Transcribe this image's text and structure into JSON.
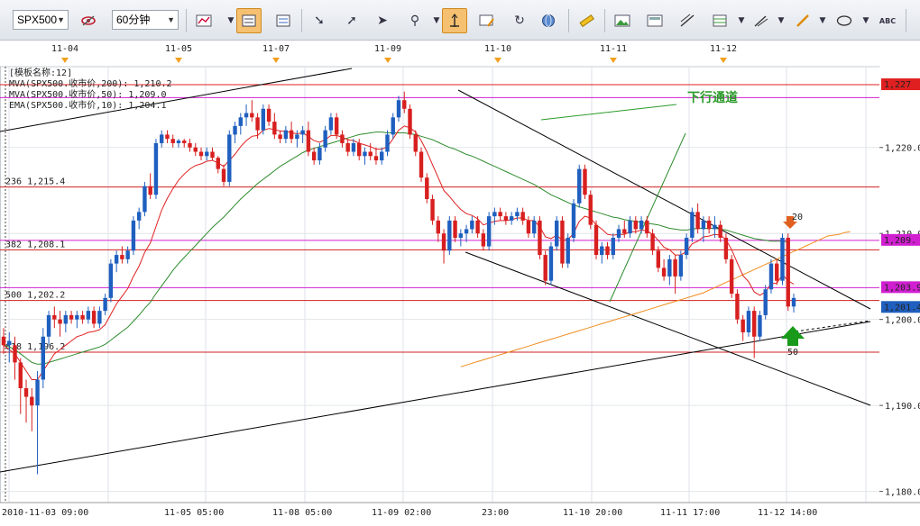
{
  "toolbar": {
    "symbol": "SPX500",
    "interval": "60分钟",
    "icons": [
      "eye-off-icon",
      "bar-chart-icon",
      "layout-icon",
      "layout-alt-icon",
      "pointer-icon",
      "pointer-plus-icon",
      "cursor-icon",
      "zoom-icon",
      "crosshair-icon",
      "edit-chart-icon",
      "refresh-icon",
      "globe-icon",
      "ruler-icon",
      "image-icon",
      "image-alt-icon",
      "trend-tool-icon",
      "grid-tool-icon",
      "pen-tool-icon",
      "brush-icon",
      "ellipse-icon",
      "text-icon"
    ]
  },
  "colors": {
    "bull": "#1f5fbf",
    "bear": "#d81f1f",
    "ema10": "#e02020",
    "ma50": "#2e8b2e",
    "ma200": "#f08c1c",
    "hline_red": "#d22020",
    "hline_magenta": "#d020d0",
    "channel": "#000000",
    "annotation_green": "#2a9a2a"
  },
  "chart_data": {
    "type": "candlestick",
    "symbol": "SPX500",
    "timeframe": "60分钟",
    "template_label": "[模板名称:12]",
    "legend": [
      {
        "text": "MVA(SPX500.收市价,200): 1,210.2",
        "color": "#f08c1c"
      },
      {
        "text": "MVA(SPX500.收市价,50): 1,209.0",
        "color": "#2e8b2e"
      },
      {
        "text": "EMA(SPX500.收市价,10): 1,204.1",
        "color": "#e02020"
      }
    ],
    "top_date_labels": [
      "11-04",
      "11-05",
      "11-07",
      "11-09",
      "11-10",
      "11-11",
      "11-12"
    ],
    "x_labels": [
      "2010-11-03 09:00",
      "11-05 05:00",
      "11-08 05:00",
      "11-09 02:00",
      "23:00",
      "11-10 20:00",
      "11-11 17:00",
      "11-12 14:00"
    ],
    "y_ticks": [
      "1,220.0",
      "1,210.0",
      "1,200.0",
      "1,190.0",
      "1,180.0"
    ],
    "ylim": [
      1178.7,
      1229.4
    ],
    "price_labels": [
      {
        "value": "1,227",
        "color": "#e02020"
      },
      {
        "value": "1,209.",
        "color": "#d020d0"
      },
      {
        "value": "1,203.9",
        "color": "#d020d0"
      },
      {
        "value": "1,201.4",
        "color": "#1f5fbf"
      }
    ],
    "fib_levels": [
      {
        "label": "236  1,215.4",
        "price": 1215.4
      },
      {
        "label": "382  1,208.1",
        "price": 1208.1
      },
      {
        "label": "500  1,202.2",
        "price": 1202.2
      },
      {
        "label": "618  1,196.2",
        "price": 1196.2
      }
    ],
    "horizontal_lines": [
      {
        "price": 1227.3,
        "color": "#e02020"
      },
      {
        "price": 1225.8,
        "color": "#d020d0"
      },
      {
        "price": 1209.2,
        "color": "#d020d0"
      },
      {
        "price": 1203.7,
        "color": "#d020d0"
      }
    ],
    "annotation_text": "下行通道",
    "signals": [
      {
        "label": "20",
        "type": "down"
      },
      {
        "label": "50",
        "type": "up"
      }
    ],
    "candles": [
      [
        1198,
        1199,
        1196,
        1197
      ],
      [
        1197,
        1198.5,
        1195,
        1197.5
      ],
      [
        1197,
        1198,
        1193,
        1195
      ],
      [
        1195,
        1195.5,
        1189,
        1192
      ],
      [
        1192,
        1193,
        1188,
        1191
      ],
      [
        1191,
        1192,
        1187,
        1190
      ],
      [
        1190,
        1194,
        1182,
        1193
      ],
      [
        1193,
        1199,
        1192,
        1198
      ],
      [
        1198,
        1201,
        1197,
        1200.5
      ],
      [
        1200.5,
        1201.5,
        1199,
        1200
      ],
      [
        1200,
        1201,
        1198,
        1199.5
      ],
      [
        1199.5,
        1201,
        1198.5,
        1200.5
      ],
      [
        1200.5,
        1201,
        1199.5,
        1200
      ],
      [
        1200,
        1201,
        1199,
        1200.5
      ],
      [
        1200.5,
        1201,
        1199.5,
        1200
      ],
      [
        1200,
        1201.5,
        1199.5,
        1201
      ],
      [
        1201,
        1201.5,
        1199,
        1199.5
      ],
      [
        1199.5,
        1201.5,
        1199,
        1201
      ],
      [
        1201,
        1203,
        1200.5,
        1202.5
      ],
      [
        1202.5,
        1207,
        1202,
        1206.5
      ],
      [
        1206.5,
        1208,
        1205.5,
        1207.5
      ],
      [
        1207.5,
        1208.5,
        1206.5,
        1207
      ],
      [
        1207,
        1208.5,
        1206.5,
        1208
      ],
      [
        1208,
        1212,
        1207.5,
        1211.5
      ],
      [
        1211.5,
        1213,
        1210.5,
        1212.5
      ],
      [
        1212.5,
        1216,
        1212,
        1215.5
      ],
      [
        1215.5,
        1217,
        1214,
        1214.5
      ],
      [
        1214.5,
        1221,
        1214,
        1220.5
      ],
      [
        1220.5,
        1222,
        1220,
        1221.5
      ],
      [
        1221.5,
        1222,
        1220.5,
        1221
      ],
      [
        1221,
        1221.5,
        1220,
        1220.5
      ],
      [
        1220.5,
        1221,
        1220,
        1220.8
      ],
      [
        1220.8,
        1221,
        1220,
        1220.5
      ],
      [
        1220.5,
        1221,
        1219.5,
        1220
      ],
      [
        1220,
        1220.5,
        1219,
        1219.5
      ],
      [
        1219.5,
        1220,
        1218.5,
        1219
      ],
      [
        1219,
        1220,
        1218.5,
        1219.5
      ],
      [
        1219.5,
        1220,
        1218.5,
        1218.8
      ],
      [
        1218.8,
        1219,
        1217,
        1217.5
      ],
      [
        1217.5,
        1218,
        1215.5,
        1216
      ],
      [
        1216,
        1222,
        1215.5,
        1221.5
      ],
      [
        1221.5,
        1223,
        1220.5,
        1222.5
      ],
      [
        1222.5,
        1224,
        1221.5,
        1223.5
      ],
      [
        1223.5,
        1225,
        1222.5,
        1224
      ],
      [
        1224,
        1225.5,
        1223,
        1223.5
      ],
      [
        1223.5,
        1224,
        1221,
        1222
      ],
      [
        1222,
        1225,
        1221.5,
        1224.5
      ],
      [
        1224.5,
        1225,
        1222.5,
        1223
      ],
      [
        1223,
        1224,
        1221,
        1221.5
      ],
      [
        1221.5,
        1222,
        1220.5,
        1221
      ],
      [
        1221,
        1222.5,
        1220.5,
        1222
      ],
      [
        1222,
        1223,
        1220.5,
        1221
      ],
      [
        1221,
        1222,
        1220,
        1221.5
      ],
      [
        1221.5,
        1222.5,
        1220.5,
        1222
      ],
      [
        1222,
        1223,
        1219,
        1219.5
      ],
      [
        1219.5,
        1220,
        1218,
        1218.5
      ],
      [
        1218.5,
        1220.5,
        1218,
        1220
      ],
      [
        1220,
        1222.5,
        1219.5,
        1222
      ],
      [
        1222,
        1224,
        1221.5,
        1223.5
      ],
      [
        1223.5,
        1224,
        1221,
        1221.5
      ],
      [
        1221.5,
        1222,
        1220,
        1220.5
      ],
      [
        1220.5,
        1221,
        1219,
        1219.5
      ],
      [
        1219.5,
        1221,
        1219,
        1220.5
      ],
      [
        1220.5,
        1221,
        1218.5,
        1219
      ],
      [
        1219,
        1220,
        1218,
        1219.5
      ],
      [
        1219.5,
        1220.5,
        1218.5,
        1219
      ],
      [
        1219,
        1220,
        1218,
        1218.5
      ],
      [
        1218.5,
        1220,
        1218,
        1219.5
      ],
      [
        1219.5,
        1222,
        1219,
        1221.5
      ],
      [
        1221.5,
        1224,
        1221,
        1223.5
      ],
      [
        1223.5,
        1226,
        1223,
        1225.5
      ],
      [
        1225.5,
        1226.5,
        1224,
        1224.5
      ],
      [
        1224.5,
        1225,
        1221,
        1221.5
      ],
      [
        1221.5,
        1222,
        1219,
        1219.5
      ],
      [
        1219.5,
        1220,
        1216,
        1216.5
      ],
      [
        1216.5,
        1217,
        1213.5,
        1214
      ],
      [
        1214,
        1214.5,
        1211,
        1211.5
      ],
      [
        1211.5,
        1212,
        1209,
        1210
      ],
      [
        1210,
        1210.5,
        1206.5,
        1208
      ],
      [
        1208,
        1212,
        1207.5,
        1211.5
      ],
      [
        1211.5,
        1212,
        1209,
        1209.5
      ],
      [
        1209.5,
        1210.5,
        1208.5,
        1210
      ],
      [
        1210,
        1211,
        1209,
        1210.5
      ],
      [
        1210.5,
        1212,
        1210,
        1211.5
      ],
      [
        1211.5,
        1212,
        1209.5,
        1210
      ],
      [
        1210,
        1210.5,
        1208,
        1208.5
      ],
      [
        1208.5,
        1212.5,
        1208,
        1212
      ],
      [
        1212,
        1213,
        1211,
        1212.5
      ],
      [
        1212.5,
        1213,
        1211.5,
        1212
      ],
      [
        1212,
        1212.5,
        1211,
        1211.5
      ],
      [
        1211.5,
        1212.5,
        1211,
        1212
      ],
      [
        1212,
        1213,
        1211.5,
        1212.5
      ],
      [
        1212.5,
        1213,
        1211,
        1211.5
      ],
      [
        1211.5,
        1212,
        1209.5,
        1210
      ],
      [
        1210,
        1212,
        1209.5,
        1211.5
      ],
      [
        1211.5,
        1212,
        1207,
        1207.5
      ],
      [
        1207.5,
        1208,
        1204,
        1204.5
      ],
      [
        1204.5,
        1209,
        1204,
        1208.5
      ],
      [
        1208.5,
        1212,
        1208,
        1211.5
      ],
      [
        1211.5,
        1212,
        1206,
        1206.5
      ],
      [
        1206.5,
        1210,
        1206,
        1209.5
      ],
      [
        1209.5,
        1214,
        1209,
        1213.5
      ],
      [
        1213.5,
        1218,
        1213,
        1217.5
      ],
      [
        1217.5,
        1218,
        1214,
        1214.5
      ],
      [
        1214.5,
        1215,
        1210.5,
        1211
      ],
      [
        1211,
        1211.5,
        1207,
        1207.5
      ],
      [
        1207.5,
        1209,
        1206.5,
        1208.5
      ],
      [
        1208.5,
        1209,
        1207,
        1207.5
      ],
      [
        1207.5,
        1210,
        1207,
        1209.5
      ],
      [
        1209.5,
        1211,
        1209,
        1210.5
      ],
      [
        1210.5,
        1211.5,
        1209.5,
        1210
      ],
      [
        1210,
        1212,
        1209.5,
        1211.5
      ],
      [
        1211.5,
        1212,
        1210,
        1210.5
      ],
      [
        1210.5,
        1212,
        1210,
        1211.5
      ],
      [
        1211.5,
        1212,
        1209.5,
        1210
      ],
      [
        1210,
        1210.5,
        1207.5,
        1208
      ],
      [
        1208,
        1208.5,
        1205.5,
        1206
      ],
      [
        1206,
        1207,
        1204.5,
        1205
      ],
      [
        1205,
        1207.5,
        1204,
        1207
      ],
      [
        1207,
        1207.5,
        1203,
        1205
      ],
      [
        1205,
        1208,
        1204.5,
        1207.5
      ],
      [
        1207.5,
        1210,
        1207,
        1209.5
      ],
      [
        1209.5,
        1213,
        1209,
        1212.5
      ],
      [
        1212.5,
        1213.5,
        1210,
        1210.5
      ],
      [
        1210.5,
        1212,
        1209,
        1211.5
      ],
      [
        1211.5,
        1212,
        1210,
        1210.5
      ],
      [
        1210.5,
        1212,
        1209.5,
        1211
      ],
      [
        1211,
        1211.5,
        1209,
        1209.5
      ],
      [
        1209.5,
        1210,
        1206.5,
        1207
      ],
      [
        1207,
        1207.5,
        1202.5,
        1203
      ],
      [
        1203,
        1203.5,
        1199.5,
        1200
      ],
      [
        1200,
        1200.5,
        1197.5,
        1198.5
      ],
      [
        1198.5,
        1201.5,
        1198,
        1201
      ],
      [
        1201,
        1201.5,
        1195.5,
        1198
      ],
      [
        1198,
        1201,
        1197.5,
        1200.5
      ],
      [
        1200.5,
        1204,
        1200,
        1203.5
      ],
      [
        1203.5,
        1207,
        1203,
        1206.5
      ],
      [
        1206.5,
        1207,
        1204,
        1204.5
      ],
      [
        1204.5,
        1210,
        1204,
        1209.5
      ],
      [
        1209.5,
        1210,
        1201,
        1201.5
      ],
      [
        1201.5,
        1203,
        1200.8,
        1202.5
      ]
    ],
    "ema10": [
      1197,
      1196.5,
      1196,
      1195,
      1194,
      1193,
      1193,
      1194,
      1195,
      1196,
      1196.5,
      1197,
      1197.5,
      1198,
      1198.2,
      1198.5,
      1198.6,
      1198.8,
      1199.4,
      1200.6,
      1201.8,
      1202.7,
      1203.6,
      1205,
      1206.2,
      1207.8,
      1208.9,
      1210.8,
      1212.7,
      1214.1,
      1215.2,
      1216.2,
      1216.9,
      1217.5,
      1217.9,
      1218.1,
      1218.4,
      1218.5,
      1218.2,
      1217.8,
      1218.5,
      1219.2,
      1220.1,
      1220.8,
      1221.3,
      1221.4,
      1222,
      1222.2,
      1222.1,
      1221.9,
      1221.9,
      1221.7,
      1221.6,
      1221.7,
      1221.3,
      1220.8,
      1220.6,
      1220.9,
      1221.4,
      1221.4,
      1221.2,
      1220.9,
      1220.8,
      1220.5,
      1220.3,
      1220.1,
      1219.8,
      1219.8,
      1220.1,
      1221,
      1222,
      1222.5,
      1222.3,
      1221.8,
      1220.8,
      1219.5,
      1218,
      1216.5,
      1215,
      1214.3,
      1213.5,
      1212.8,
      1212.3,
      1212.1,
      1211.7,
      1211,
      1211.2,
      1211.4,
      1211.5,
      1211.5,
      1211.6,
      1211.8,
      1211.8,
      1211.5,
      1211.5,
      1210.8,
      1209.6,
      1209.4,
      1209.8,
      1209.2,
      1209.3,
      1210,
      1211.4,
      1212,
      1211.8,
      1211,
      1210.5,
      1209.9,
      1209.8,
      1209.9,
      1209.9,
      1210.2,
      1210.2,
      1210.4,
      1210.3,
      1209.9,
      1209.2,
      1208.4,
      1208.1,
      1207.5,
      1207.5,
      1207.9,
      1208.8,
      1209.1,
      1209.6,
      1209.7,
      1209.9,
      1209.8,
      1209.3,
      1208.1,
      1206.6,
      1205.1,
      1204.4,
      1203.2,
      1202.8,
      1203.2,
      1204.2,
      1204.2,
      1205.2,
      1204.5,
      1204.1
    ],
    "ma50": [
      1197,
      1196.8,
      1196.5,
      1196,
      1195.5,
      1195,
      1194.8,
      1194.8,
      1195,
      1195.2,
      1195.4,
      1195.6,
      1195.8,
      1196,
      1196.2,
      1196.4,
      1196.6,
      1196.8,
      1197.1,
      1197.6,
      1198.1,
      1198.6,
      1199.1,
      1199.8,
      1200.5,
      1201.3,
      1202,
      1203,
      1203.9,
      1204.8,
      1205.7,
      1206.5,
      1207.2,
      1207.9,
      1208.6,
      1209.3,
      1210,
      1210.7,
      1211.3,
      1211.9,
      1212.6,
      1213.3,
      1214,
      1214.6,
      1215.2,
      1215.8,
      1216.3,
      1216.8,
      1217.3,
      1217.8,
      1218.2,
      1218.6,
      1219,
      1219.4,
      1219.7,
      1219.9,
      1220.1,
      1220.3,
      1220.5,
      1220.7,
      1220.9,
      1221.1,
      1221.3,
      1221.5,
      1221.6,
      1221.7,
      1221.8,
      1221.8,
      1221.7,
      1221.7,
      1221.7,
      1221.7,
      1221.6,
      1221.5,
      1221.3,
      1221.1,
      1220.9,
      1220.6,
      1220.3,
      1220,
      1219.8,
      1219.5,
      1219.2,
      1219,
      1218.7,
      1218.4,
      1218.1,
      1217.8,
      1217.5,
      1217.2,
      1216.9,
      1216.6,
      1216.3,
      1216,
      1215.7,
      1215.3,
      1214.9,
      1214.5,
      1214.2,
      1213.9,
      1213.6,
      1213.3,
      1213.1,
      1212.9,
      1212.7,
      1212.5,
      1212.3,
      1212.1,
      1211.9,
      1211.8,
      1211.6,
      1211.5,
      1211.4,
      1211.3,
      1211.2,
      1211.1,
      1211,
      1210.8,
      1210.6,
      1210.5,
      1210.4,
      1210.4,
      1210.5,
      1210.6,
      1210.6,
      1210.6,
      1210.6,
      1210.5,
      1210.4,
      1210.2,
      1210,
      1209.8,
      1209.6,
      1209.4,
      1209.3,
      1209.2,
      1209.1,
      1209.1,
      1209.1,
      1209
    ],
    "ma200_start_index": 81,
    "ma200": [
      1194.5,
      1194.7,
      1194.9,
      1195.1,
      1195.3,
      1195.5,
      1195.7,
      1195.9,
      1196.1,
      1196.3,
      1196.5,
      1196.7,
      1196.9,
      1197.1,
      1197.3,
      1197.5,
      1197.7,
      1197.9,
      1198.1,
      1198.3,
      1198.5,
      1198.7,
      1198.9,
      1199.1,
      1199.3,
      1199.5,
      1199.7,
      1199.9,
      1200.1,
      1200.3,
      1200.5,
      1200.7,
      1200.9,
      1201.1,
      1201.3,
      1201.5,
      1201.7,
      1201.9,
      1202.1,
      1202.3,
      1202.5,
      1202.7,
      1202.9,
      1203.1,
      1203.4,
      1203.7,
      1204,
      1204.3,
      1204.6,
      1204.9,
      1205.2,
      1205.5,
      1205.8,
      1206.1,
      1206.4,
      1206.7,
      1207,
      1207.3,
      1207.6,
      1207.9,
      1208.2,
      1208.5,
      1208.8,
      1209.1,
      1209.4,
      1209.7,
      1209.8,
      1209.9,
      1210.1,
      1210.2
    ]
  }
}
